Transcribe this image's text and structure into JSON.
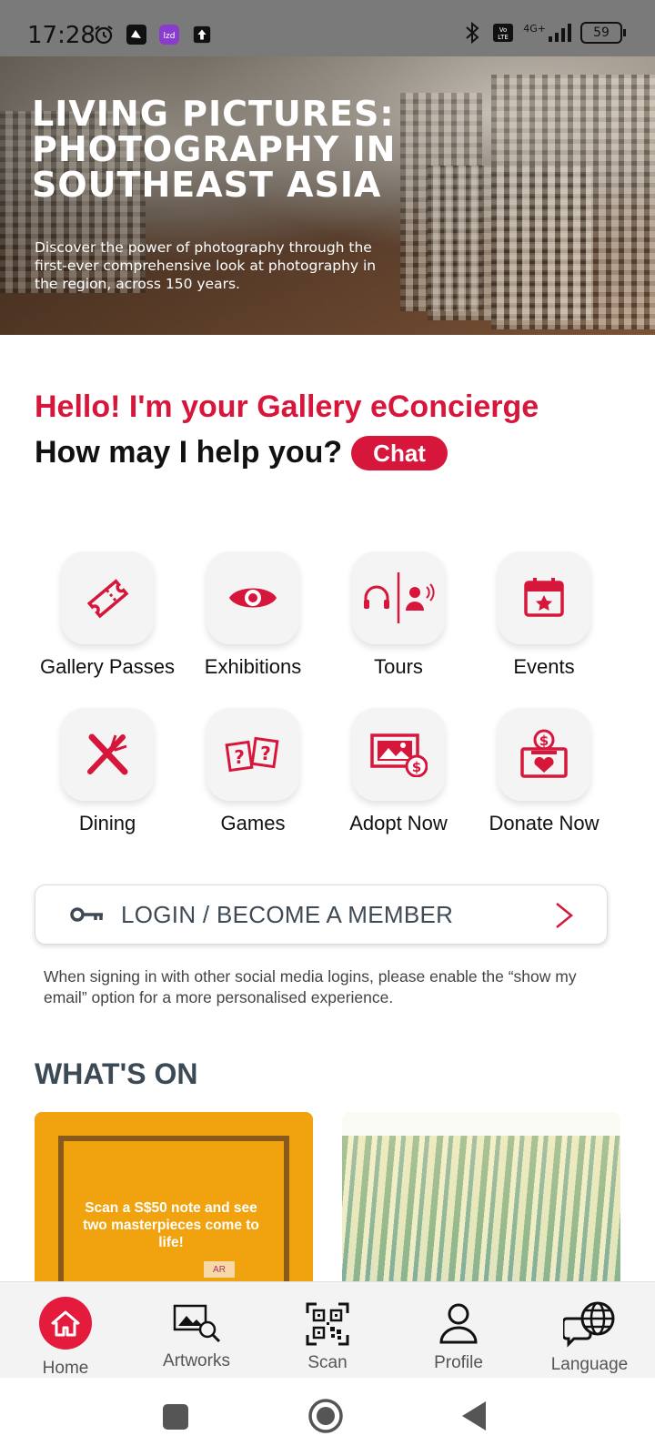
{
  "status_bar": {
    "time": "17:28",
    "battery": "59",
    "network": "4G+"
  },
  "hero": {
    "title": "LIVING PICTURES: PHOTOGRAPHY IN SOUTHEAST ASIA",
    "description": "Discover the power of photography through the first-ever comprehensive look at photography in the region, across 150 years.",
    "carousel_active_index": 1,
    "carousel_count": 5
  },
  "concierge": {
    "greeting": "Hello! I'm your Gallery eConcierge",
    "prompt": "How may I help you?",
    "chat_label": "Chat"
  },
  "shortcuts": [
    {
      "label": "Gallery Passes",
      "icon": "ticket-icon"
    },
    {
      "label": "Exhibitions",
      "icon": "eye-icon"
    },
    {
      "label": "Tours",
      "icon": "headphones-guide-icon"
    },
    {
      "label": "Events",
      "icon": "calendar-star-icon"
    },
    {
      "label": "Dining",
      "icon": "fork-knife-icon"
    },
    {
      "label": "Games",
      "icon": "question-cards-icon"
    },
    {
      "label": "Adopt Now",
      "icon": "artwork-dollar-icon"
    },
    {
      "label": "Donate Now",
      "icon": "donation-box-icon"
    }
  ],
  "login": {
    "label": "LOGIN / BECOME A MEMBER",
    "note": "When signing in with other social media logins, please enable the “show my email” option for a more personalised experience."
  },
  "whats_on": {
    "heading": "WHAT'S ON",
    "card1_text": "Scan a S$50 note and see two masterpieces come to life!",
    "card1_badge": "AR"
  },
  "bottom_nav": [
    {
      "label": "Home",
      "icon": "home-icon"
    },
    {
      "label": "Artworks",
      "icon": "artworks-search-icon"
    },
    {
      "label": "Scan",
      "icon": "qr-code-icon"
    },
    {
      "label": "Profile",
      "icon": "person-icon"
    },
    {
      "label": "Language",
      "icon": "globe-chat-icon"
    }
  ],
  "colors": {
    "accent": "#d6163b",
    "heading": "#3c4a56",
    "nav_bg": "#f3f3f3"
  }
}
